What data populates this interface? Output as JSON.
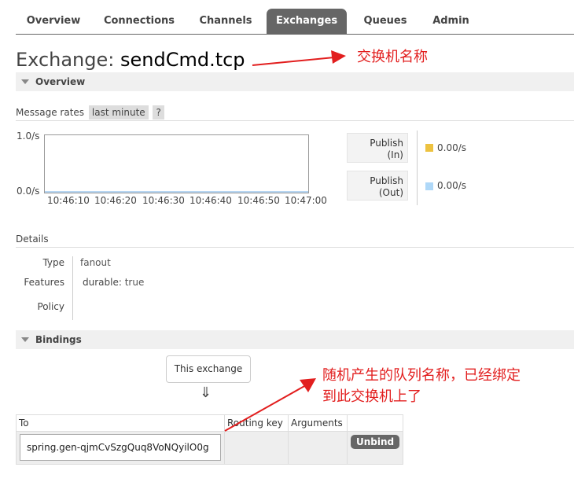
{
  "tabs": [
    {
      "label": "Overview"
    },
    {
      "label": "Connections"
    },
    {
      "label": "Channels"
    },
    {
      "label": "Exchanges"
    },
    {
      "label": "Queues"
    },
    {
      "label": "Admin"
    }
  ],
  "title": {
    "prefix": "Exchange: ",
    "name": "sendCmd.tcp"
  },
  "annotations": {
    "exchange_name": "交换机名称",
    "queue_line1": "随机产生的队列名称，已经绑定",
    "queue_line2": "到此交换机上了",
    "color": "#e21e1e"
  },
  "overview": {
    "section_label": "Overview",
    "message_rates_label": "Message rates",
    "range_option": "last minute",
    "help_label": "?",
    "chart_data": {
      "type": "line",
      "x": [
        "10:46:10",
        "10:46:20",
        "10:46:30",
        "10:46:40",
        "10:46:50",
        "10:47:00"
      ],
      "y_ticks": [
        "1.0/s",
        "0.0/s"
      ],
      "ylim": [
        0,
        1.0
      ],
      "series": [
        {
          "name": "Publish (In)",
          "values": [
            0,
            0,
            0,
            0,
            0,
            0
          ],
          "color": "#edc240"
        },
        {
          "name": "Publish (Out)",
          "values": [
            0,
            0,
            0,
            0,
            0,
            0
          ],
          "color": "#afd8f8"
        }
      ]
    },
    "legend": [
      {
        "line1": "Publish",
        "line2": "(In)",
        "value": "0.00/s",
        "color": "#edc240"
      },
      {
        "line1": "Publish",
        "line2": "(Out)",
        "value": "0.00/s",
        "color": "#afd8f8"
      }
    ]
  },
  "details": {
    "heading": "Details",
    "type_key": "Type",
    "type_value": "fanout",
    "features_key": "Features",
    "features_name": "durable:",
    "features_value": "true",
    "policy_key": "Policy"
  },
  "bindings": {
    "section_label": "Bindings",
    "this_exchange": "This exchange",
    "arrow": "⇓",
    "headers": {
      "to": "To",
      "routing_key": "Routing key",
      "arguments": "Arguments"
    },
    "rows": [
      {
        "to": "spring.gen-qjmCvSzgQuq8VoNQyilO0g",
        "routing_key": "",
        "arguments": "",
        "action": "Unbind"
      }
    ]
  }
}
